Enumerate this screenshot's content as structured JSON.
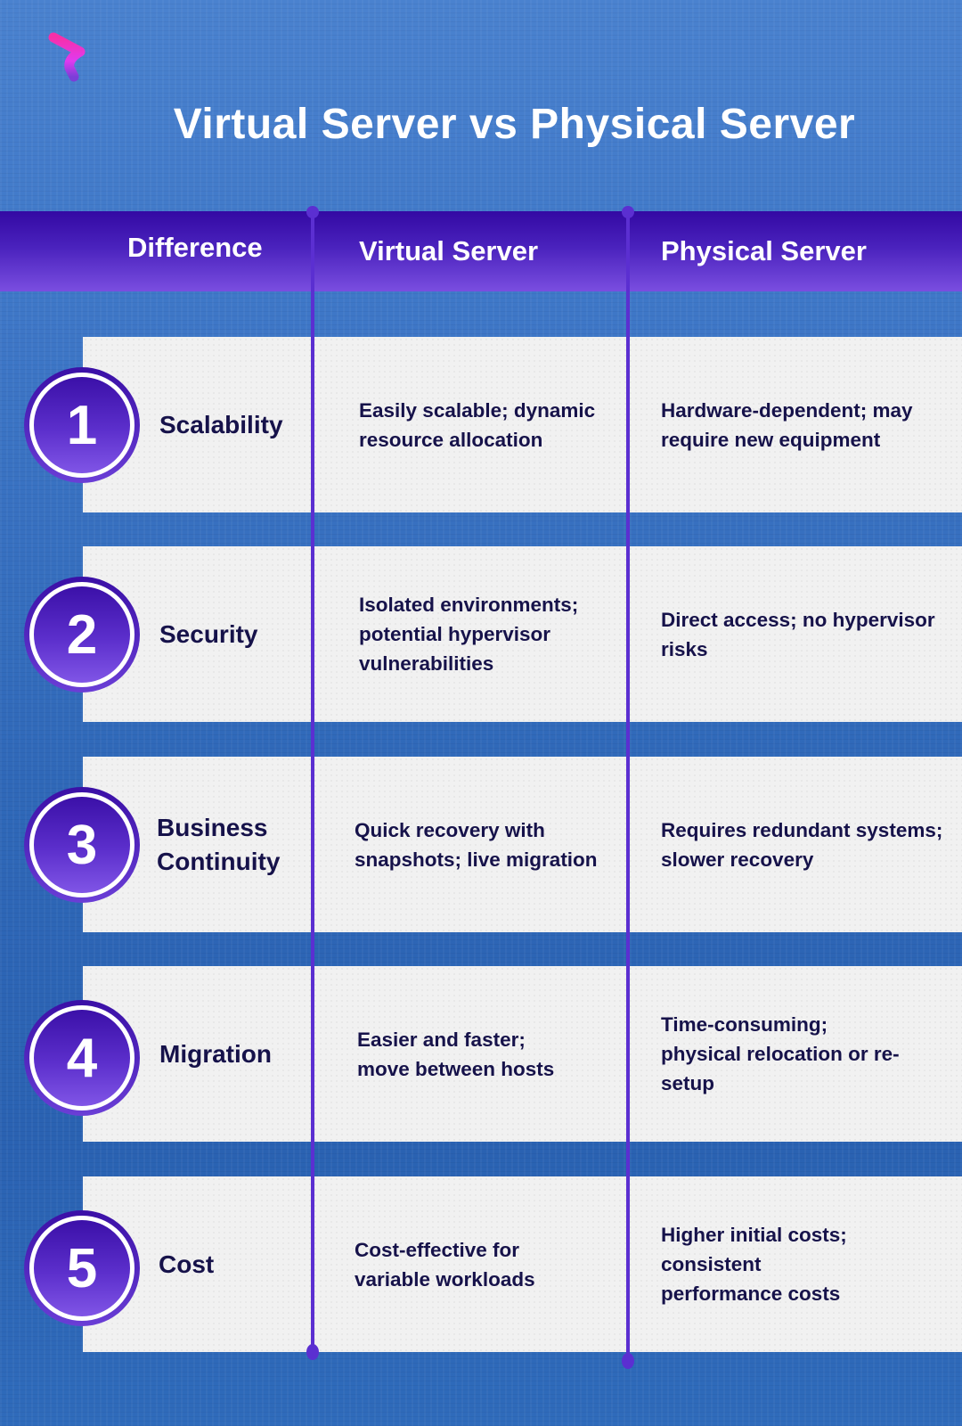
{
  "title": "Virtual Server vs Physical Server",
  "logo": {
    "icon": "brand-logo-icon",
    "colors": [
      "#f7572d",
      "#f62fae",
      "#7b3ed8"
    ]
  },
  "header": {
    "columns": [
      "Difference",
      "Virtual Server",
      "Physical Server"
    ]
  },
  "colors": {
    "header_top": "#3309a3",
    "header_bottom": "#7a4ee0",
    "divider": "#5b2fd1",
    "row_bg": "#f1f1f1",
    "text_dark": "#16124a",
    "background": "#3f78c8"
  },
  "rows": [
    {
      "number": "1",
      "difference": "Scalability",
      "virtual": "Easily scalable; dynamic resource allocation",
      "physical": "Hardware-dependent; may require new equipment"
    },
    {
      "number": "2",
      "difference": "Security",
      "virtual": "Isolated environments; potential hypervisor vulnerabilities",
      "physical": "Direct access; no hypervisor risks"
    },
    {
      "number": "3",
      "difference": "Business Continuity",
      "virtual": "Quick recovery with snapshots; live migration",
      "physical": "Requires redundant systems; slower recovery"
    },
    {
      "number": "4",
      "difference": "Migration",
      "virtual": "Easier and faster; move between hosts",
      "physical": "Time-consuming; physical relocation or re-setup"
    },
    {
      "number": "5",
      "difference": "Cost",
      "virtual": "Cost-effective for variable workloads",
      "physical": "Higher initial costs; consistent performance costs"
    }
  ]
}
